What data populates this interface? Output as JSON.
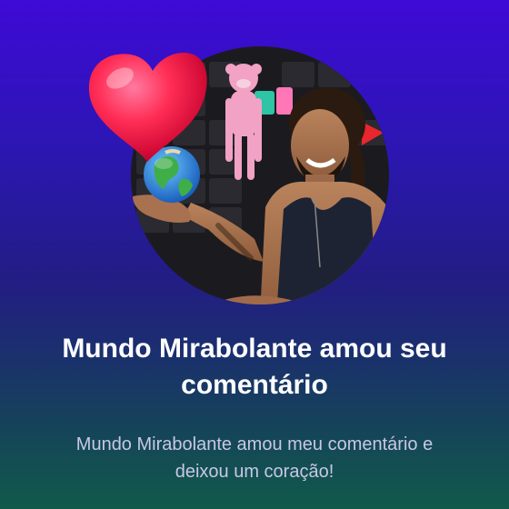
{
  "notification": {
    "title": "Mundo Mirabolante amou seu comentário",
    "subtitle": "Mundo Mirabolante amou meu comentário e deixou um coração!"
  },
  "colors": {
    "background_top": "#3e0ad6",
    "background_bottom": "#115a4a",
    "heart": "#ff2d55",
    "title_text": "#ffffff",
    "subtitle_text": "#c9c7e6"
  },
  "icons": {
    "heart": "heart-icon",
    "globe": "globe-icon"
  }
}
